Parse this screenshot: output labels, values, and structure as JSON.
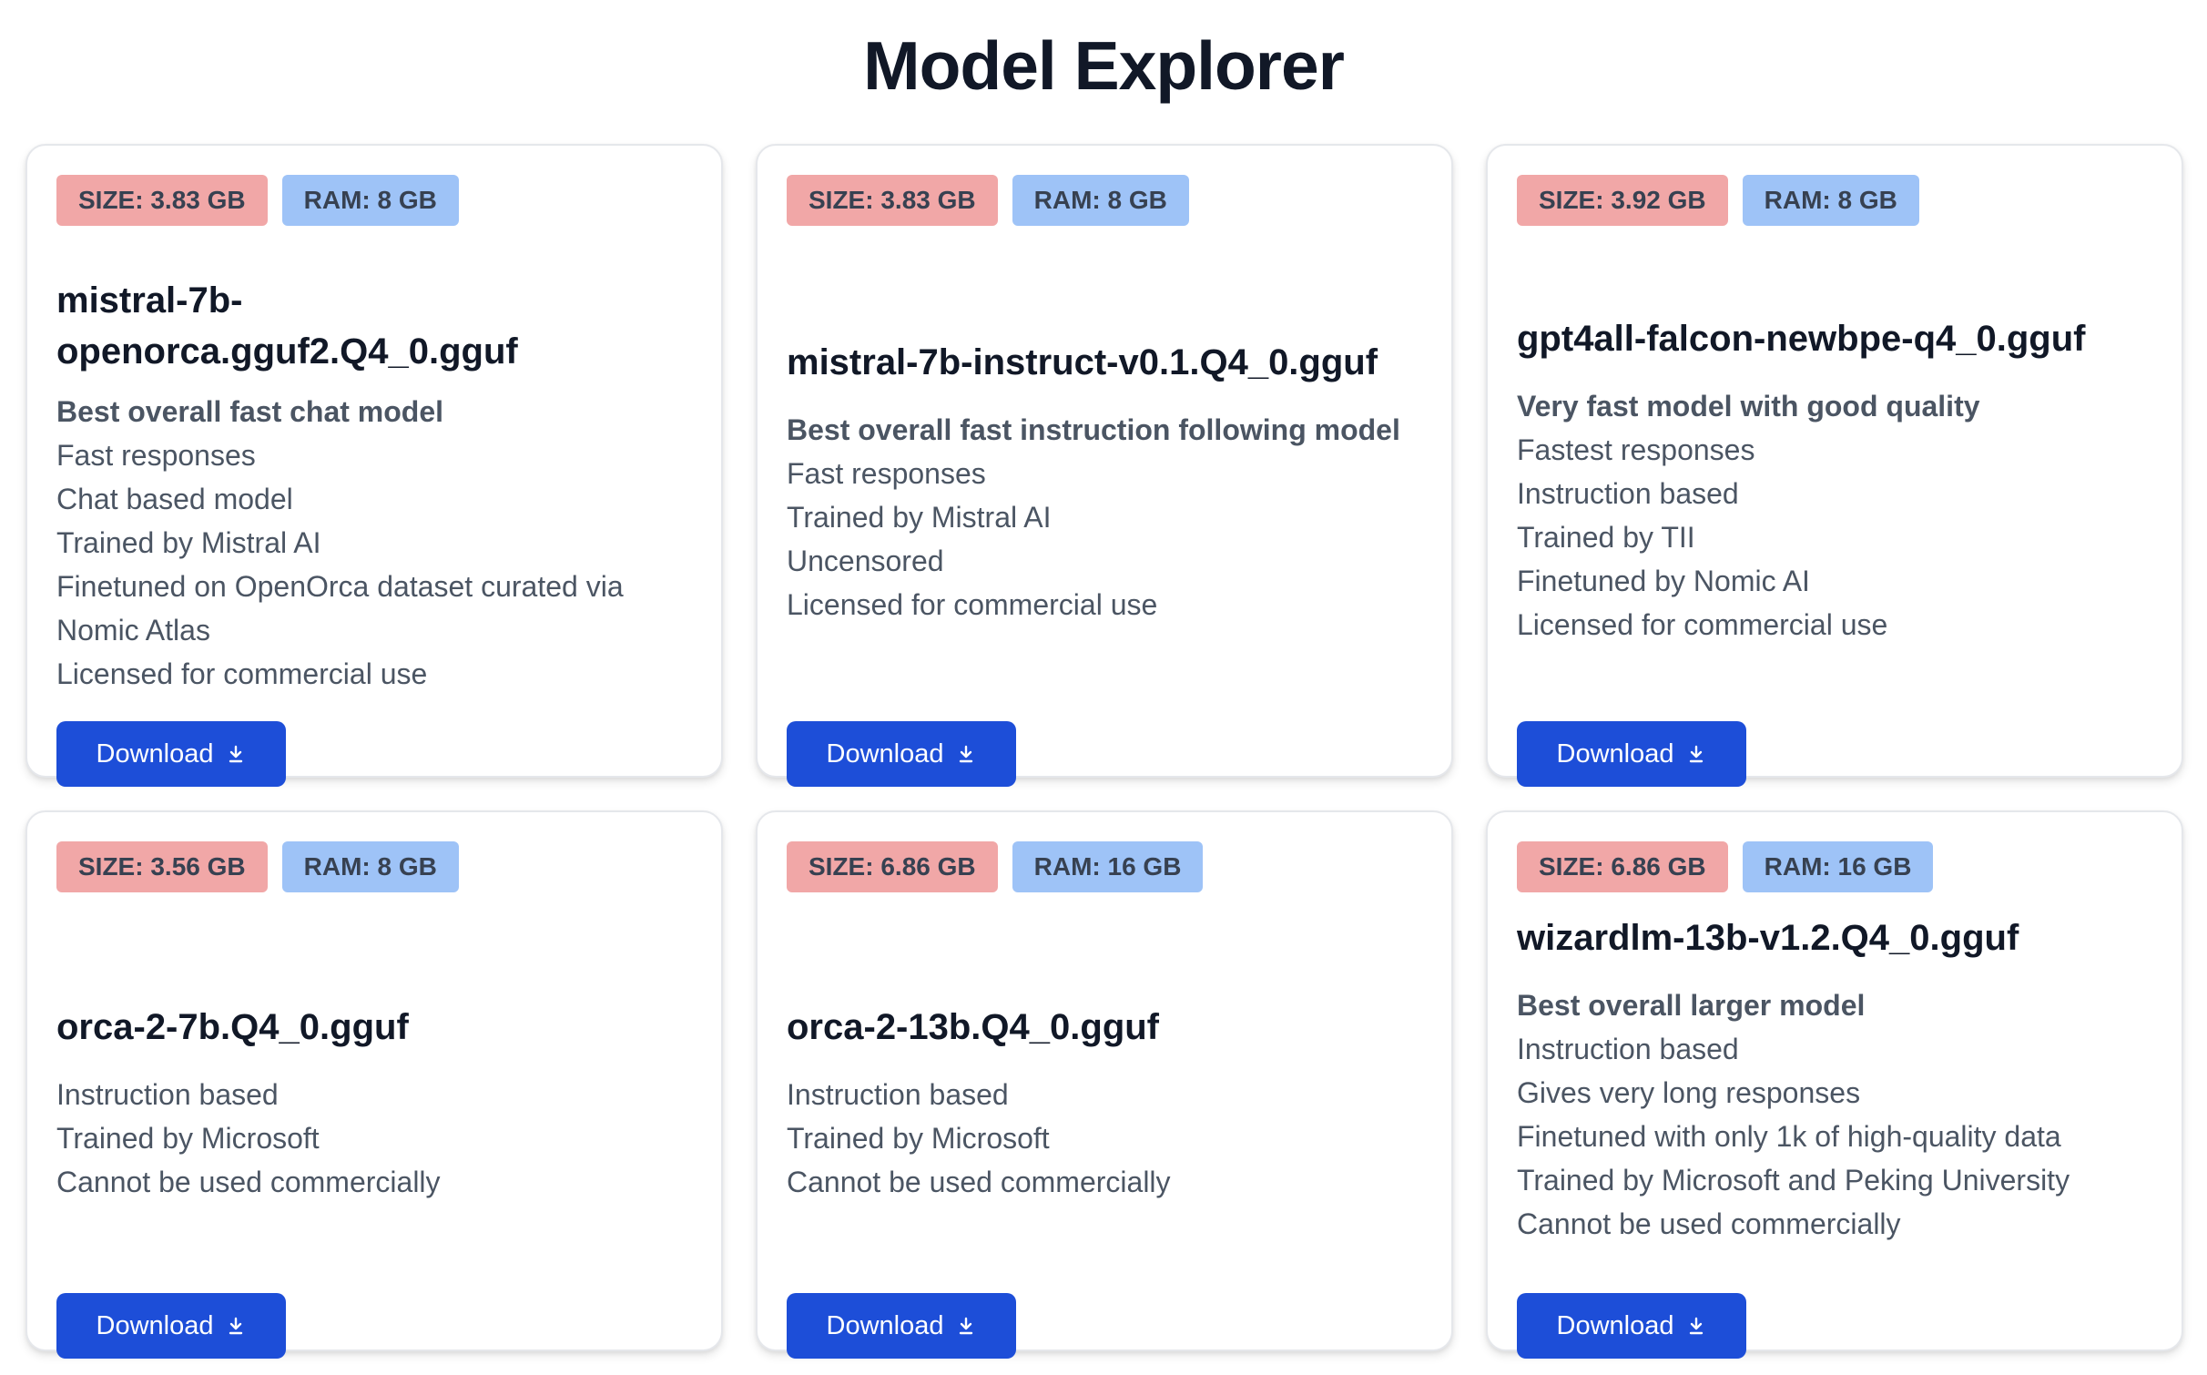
{
  "page": {
    "title": "Model Explorer"
  },
  "download_label": "Download",
  "colors": {
    "size_badge": "#f1a7a7",
    "ram_badge": "#9ec3f7",
    "button": "#1d4ed8"
  },
  "cards": [
    {
      "size": "SIZE: 3.83 GB",
      "ram": "RAM: 8 GB",
      "name": "mistral-7b-openorca.gguf2.Q4_0.gguf",
      "lead": "Best overall fast chat model",
      "details": [
        "Fast responses",
        "Chat based model",
        "Trained by Mistral AI",
        "Finetuned on OpenOrca dataset curated via Nomic Atlas",
        "Licensed for commercial use"
      ]
    },
    {
      "size": "SIZE: 3.83 GB",
      "ram": "RAM: 8 GB",
      "name": "mistral-7b-instruct-v0.1.Q4_0.gguf",
      "lead": "Best overall fast instruction following model",
      "details": [
        "Fast responses",
        "Trained by Mistral AI",
        "Uncensored",
        "Licensed for commercial use"
      ]
    },
    {
      "size": "SIZE: 3.92 GB",
      "ram": "RAM: 8 GB",
      "name": "gpt4all-falcon-newbpe-q4_0.gguf",
      "lead": "Very fast model with good quality",
      "details": [
        "Fastest responses",
        "Instruction based",
        "Trained by TII",
        "Finetuned by Nomic AI",
        "Licensed for commercial use"
      ]
    },
    {
      "size": "SIZE: 3.56 GB",
      "ram": "RAM: 8 GB",
      "name": "orca-2-7b.Q4_0.gguf",
      "details": [
        "Instruction based",
        "Trained by Microsoft",
        "Cannot be used commercially"
      ]
    },
    {
      "size": "SIZE: 6.86 GB",
      "ram": "RAM: 16 GB",
      "name": "orca-2-13b.Q4_0.gguf",
      "details": [
        "Instruction based",
        "Trained by Microsoft",
        "Cannot be used commercially"
      ]
    },
    {
      "size": "SIZE: 6.86 GB",
      "ram": "RAM: 16 GB",
      "name": "wizardlm-13b-v1.2.Q4_0.gguf",
      "lead": "Best overall larger model",
      "details": [
        "Instruction based",
        "Gives very long responses",
        "Finetuned with only 1k of high-quality data",
        "Trained by Microsoft and Peking University",
        "Cannot be used commercially"
      ]
    }
  ]
}
